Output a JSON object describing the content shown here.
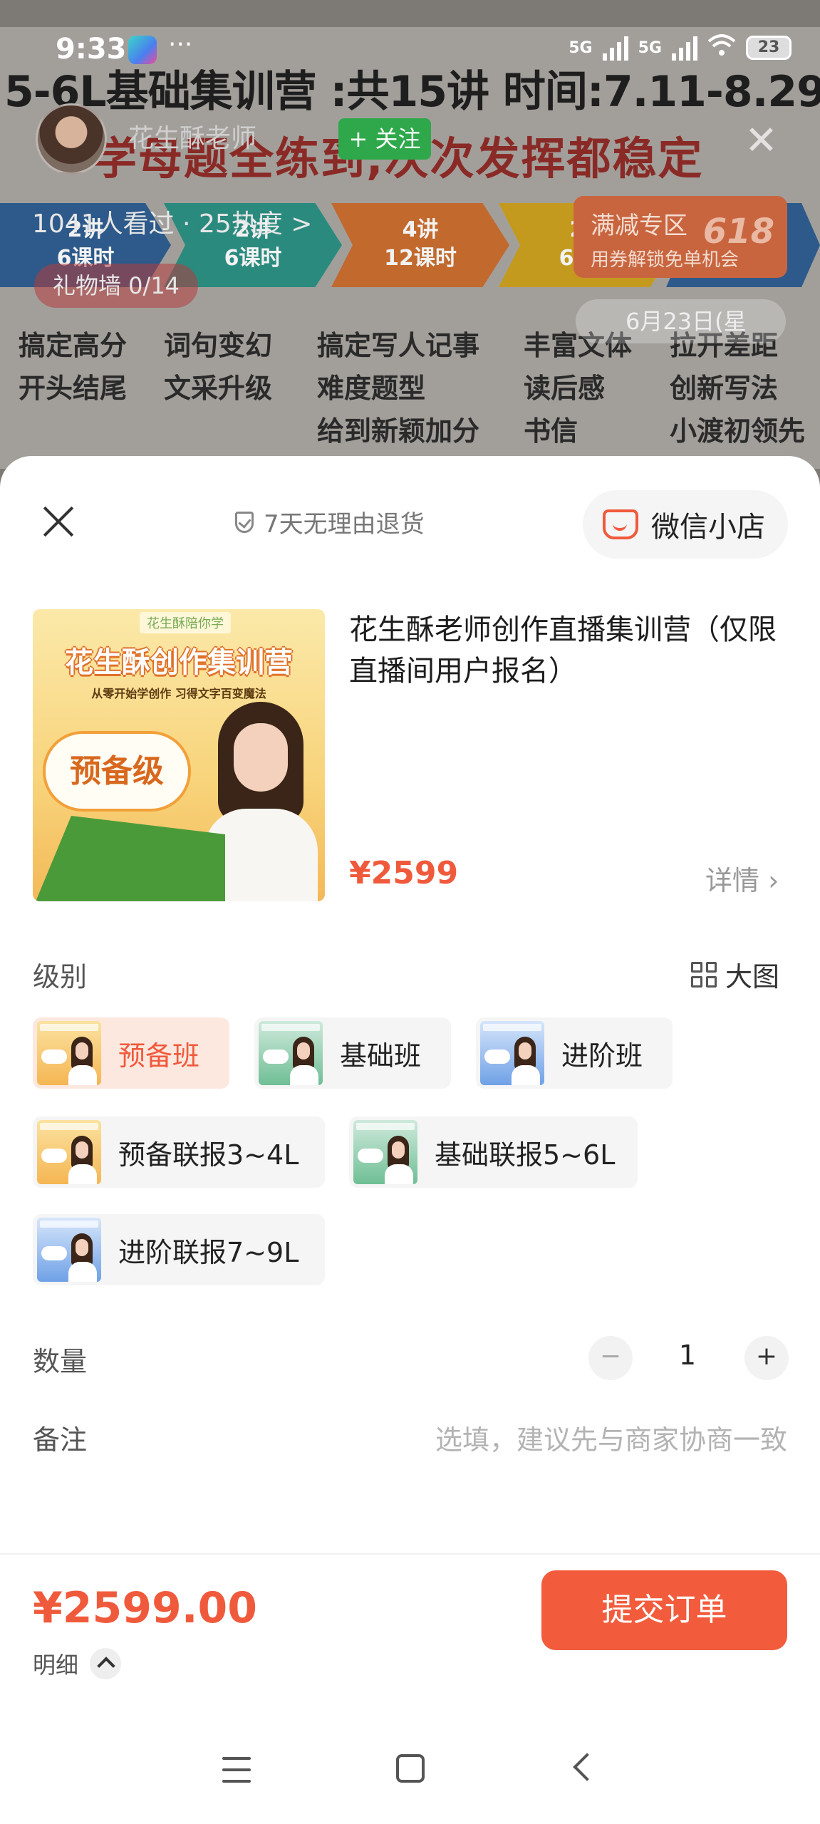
{
  "status_bar": {
    "time": "9:33",
    "dots": "···",
    "net1": "5G",
    "net2": "5G",
    "battery": "23"
  },
  "stream": {
    "headline": "5-6L基础集训营 :共15讲  时间:7.11-8.29",
    "subheadline": "学母题全练到,次次发挥都稳定",
    "streamer_name": "花生酥老师",
    "follow_label": "+ 关注",
    "viewers": "1041人看过 · 25热度 >",
    "gift_wall": "礼物墙 0/14",
    "promo_title": "满减专区",
    "promo_sub": "用券解锁免单机会",
    "promo_number": "618",
    "date_chip": "6月23日(星",
    "arrows": [
      {
        "l1": "2讲",
        "l2": "6课时"
      },
      {
        "l1": "2讲",
        "l2": "6课时"
      },
      {
        "l1": "4讲",
        "l2": "12课时"
      },
      {
        "l1": "2讲",
        "l2": "6课时"
      },
      {
        "l1": "",
        "l2": ""
      }
    ],
    "topics": [
      [
        "搞定高分",
        "开头结尾"
      ],
      [
        "词句变幻",
        "文采升级"
      ],
      [
        "搞定写人记事",
        "难度题型",
        "给到新颖加分"
      ],
      [
        "丰富文体",
        "读后感",
        "书信"
      ],
      [
        "拉开差距",
        "创新写法",
        "小渡初领先"
      ]
    ]
  },
  "sheet": {
    "guarantee": "7天无理由退货",
    "store_label": "微信小店",
    "product": {
      "title": "花生酥老师创作直播集训营（仅限直播间用户报名）",
      "price": "¥2599",
      "details_label": "详情",
      "image": {
        "badge": "花生酥陪你学",
        "title": "花生酥创作集训营",
        "subtitle": "从零开始学创作  习得文字百变魔法",
        "level": "预备级"
      }
    },
    "level_label": "级别",
    "bigpic_label": "大图",
    "options": [
      {
        "label": "预备班",
        "selected": true
      },
      {
        "label": "基础班",
        "selected": false
      },
      {
        "label": "进阶班",
        "selected": false
      },
      {
        "label": "预备联报3~4L",
        "selected": false
      },
      {
        "label": "基础联报5~6L",
        "selected": false
      },
      {
        "label": "进阶联报7~9L",
        "selected": false
      }
    ],
    "quantity_label": "数量",
    "quantity": 1,
    "minus": "−",
    "plus": "+",
    "note_label": "备注",
    "note_placeholder": "选填，建议先与商家协商一致"
  },
  "footer": {
    "total": "¥2599.00",
    "breakdown_label": "明细",
    "submit_label": "提交订单"
  },
  "colors": {
    "accent": "#f25c3d",
    "selected_bg": "#fde8df",
    "follow": "#2fa84b"
  }
}
